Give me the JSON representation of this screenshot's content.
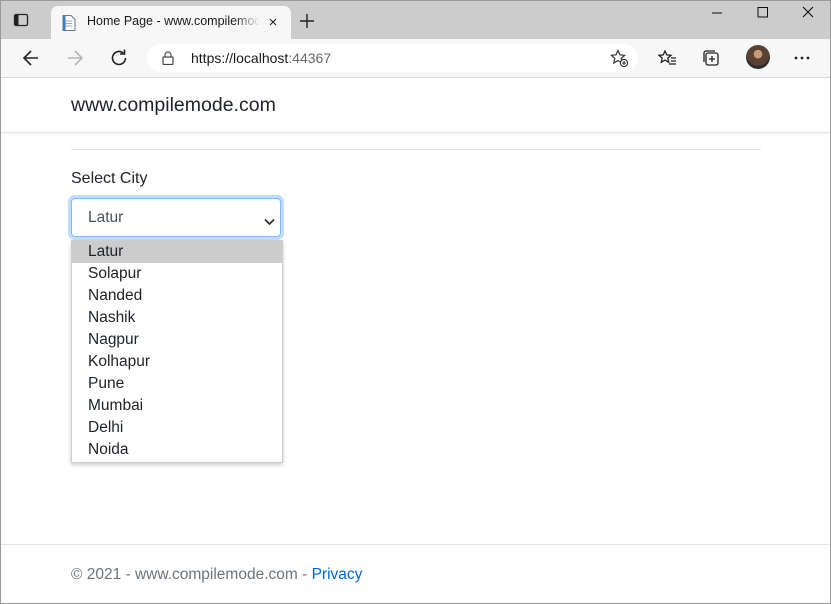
{
  "browser": {
    "tab": {
      "title": "Home Page - www.compilemode.com",
      "close_glyph": "×",
      "favicon": "page-icon"
    },
    "address": {
      "url_prefix": "https://",
      "url_host": "localhost",
      "url_port": ":44367"
    },
    "icons": [
      "tab-actions-icon",
      "new-tab-icon",
      "minimize-icon",
      "maximize-icon",
      "close-window-icon",
      "back-icon",
      "forward-icon",
      "refresh-icon",
      "lock-icon",
      "add-favorite-icon",
      "favorites-icon",
      "collections-icon",
      "profile-avatar",
      "more-icon"
    ]
  },
  "site": {
    "brand": "www.compilemode.com"
  },
  "form": {
    "label": "Select City",
    "selected_value": "Latur",
    "options": [
      "Latur",
      "Solapur",
      "Nanded",
      "Nashik",
      "Nagpur",
      "Kolhapur",
      "Pune",
      "Mumbai",
      "Delhi",
      "Noida"
    ],
    "highlighted_index": 0
  },
  "footer": {
    "text": "© 2021 - www.compilemode.com - ",
    "link": "Privacy"
  },
  "colors": {
    "titlebar": "#cccccc",
    "toolbar": "#f7f7f7",
    "focus_ring": "#80bdff",
    "link": "#0366d6",
    "option_highlight": "#cccccc"
  }
}
